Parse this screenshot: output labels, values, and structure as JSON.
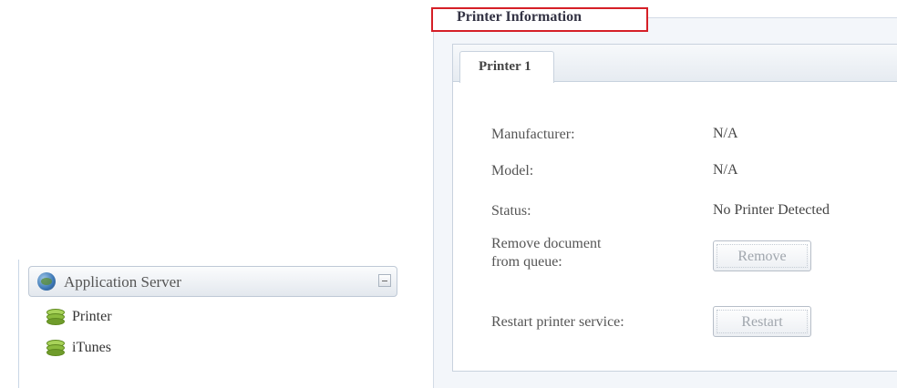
{
  "sidebar": {
    "header_title": "Application Server",
    "items": [
      {
        "label": "Printer",
        "icon": "stack-icon"
      },
      {
        "label": "iTunes",
        "icon": "stack-icon"
      }
    ]
  },
  "printer_info": {
    "legend": "Printer Information",
    "tab_label": "Printer 1",
    "rows": [
      {
        "label": "Manufacturer:",
        "value": "N/A"
      },
      {
        "label": "Model:",
        "value": "N/A"
      },
      {
        "label": "Status:",
        "value": "No Printer Detected"
      }
    ],
    "remove_label_line1": "Remove document",
    "remove_label_line2": "from queue:",
    "remove_button": "Remove",
    "restart_label": "Restart printer service:",
    "restart_button": "Restart"
  },
  "colors": {
    "highlight_box": "#d51f27",
    "panel_bg": "#f3f6fa",
    "stack_icon_green": "#8bbb3e"
  }
}
